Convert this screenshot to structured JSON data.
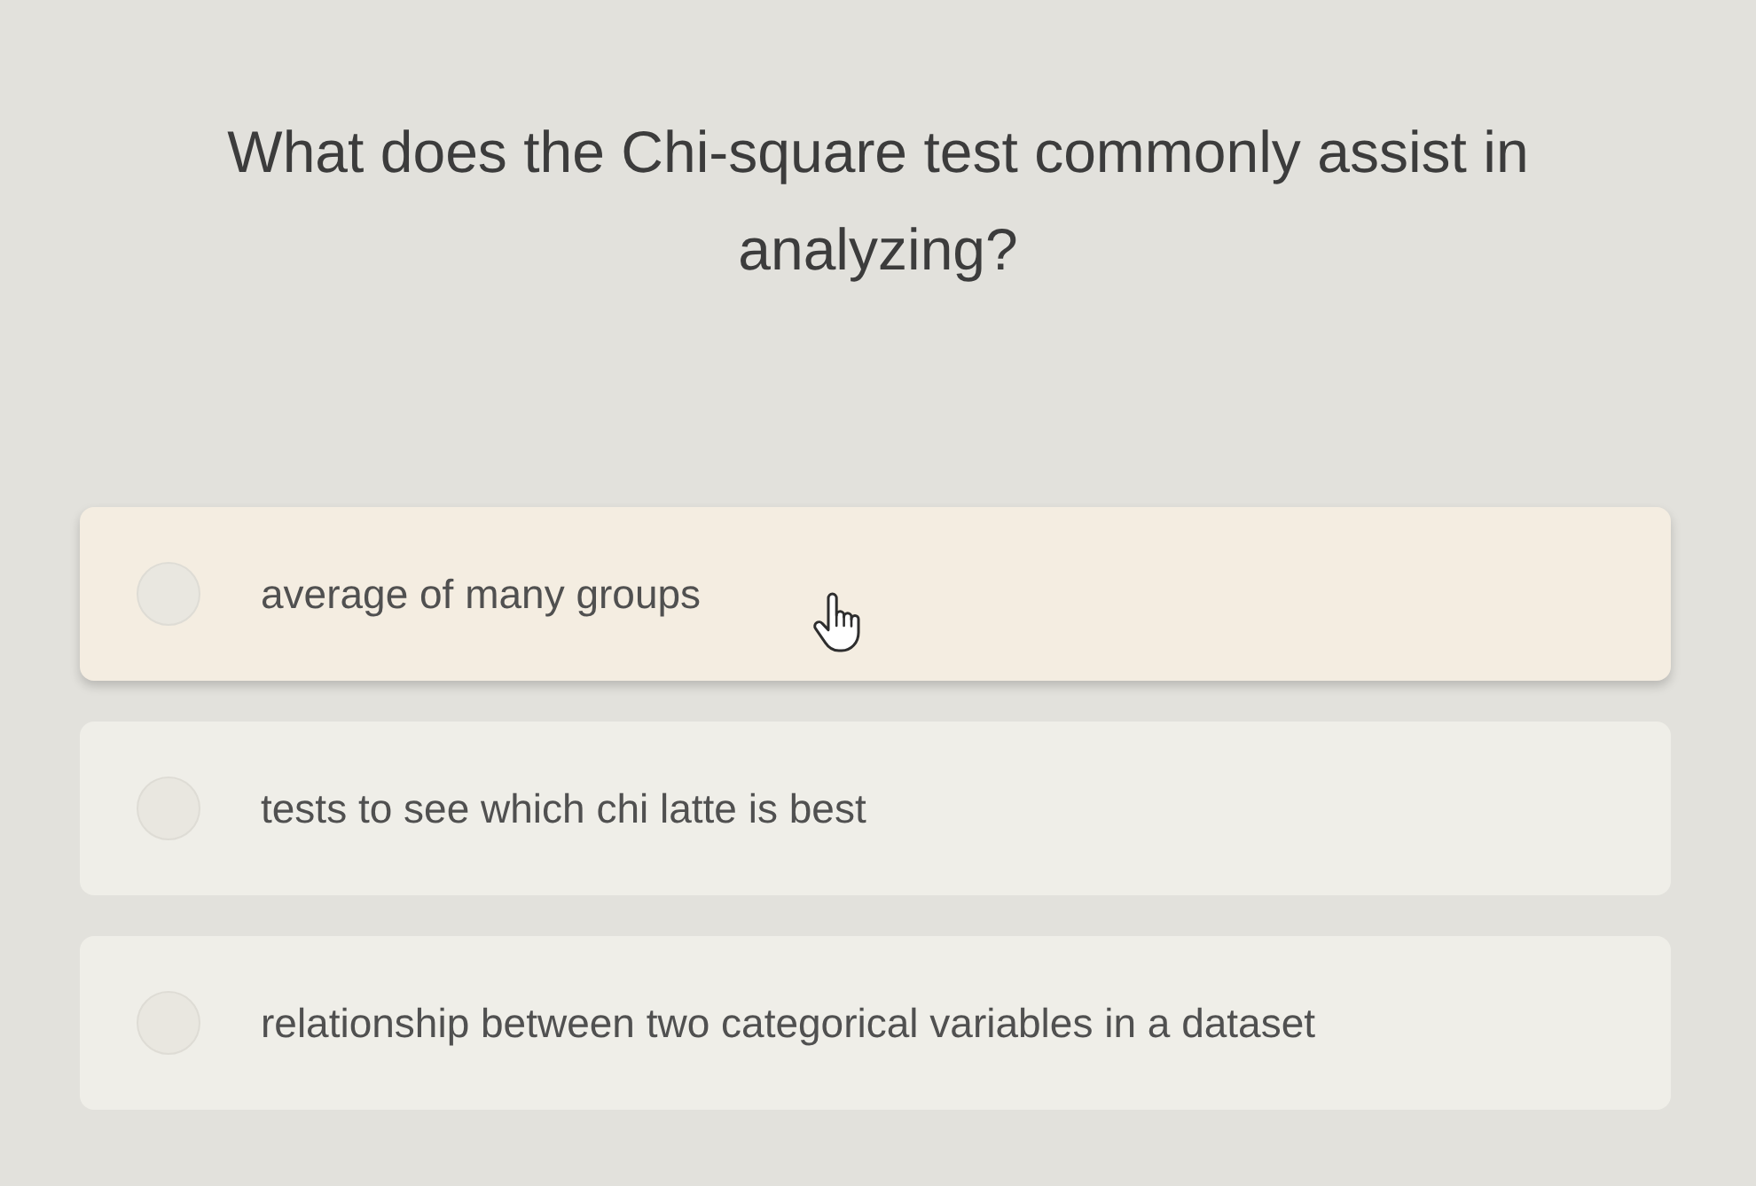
{
  "question": "What does the Chi-square test commonly assist in analyzing?",
  "options": [
    {
      "label": "average of many groups",
      "selected": false,
      "hovered": true
    },
    {
      "label": "tests to see which chi latte is best",
      "selected": false,
      "hovered": false
    },
    {
      "label": "relationship between two categorical variables in a dataset",
      "selected": false,
      "hovered": false
    }
  ]
}
